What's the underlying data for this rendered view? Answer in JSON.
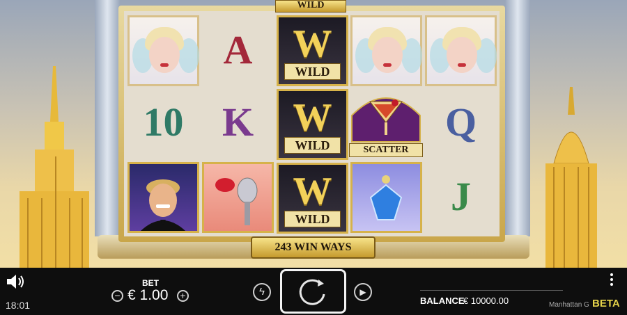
{
  "game": {
    "top_banner": "WILD",
    "win_ways_banner": "243 WIN WAYS",
    "symbols": {
      "wild_label": "WILD",
      "wild_letter": "W",
      "scatter_label": "SCATTER",
      "ace": "A",
      "king": "K",
      "ten": "10",
      "queen": "Q",
      "jack": "J"
    }
  },
  "bottom_bar": {
    "time": "18:01",
    "bet_label": "BET",
    "bet_value": "€ 1.00",
    "minus_icon": "minus-circle-icon",
    "plus_icon": "plus-circle-icon",
    "balance_label": "BALANCE",
    "balance_value": "€ 10000.00",
    "footer_title": "Manhattan G",
    "beta_badge": "BETA",
    "sound_icon": "speaker-icon",
    "menu_icon": "more-vertical-icon",
    "turbo_icon": "lightning-icon",
    "spin_icon": "refresh-icon",
    "autoplay_icon": "play-icon"
  },
  "colors": {
    "gold": "#d6b24a",
    "beta": "#e4d24a",
    "bar_bg": "#0e0e0e"
  }
}
